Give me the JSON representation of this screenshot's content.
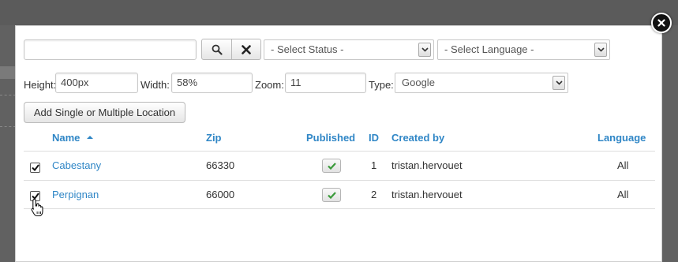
{
  "toolbar": {
    "search": {
      "value": "",
      "placeholder": ""
    },
    "status_select": {
      "selected": "- Select Status -"
    },
    "language_select": {
      "selected": "- Select Language -"
    }
  },
  "map_settings": {
    "height_label": "Height:",
    "height_value": "400px",
    "width_label": "Width:",
    "width_value": "58%",
    "zoom_label": "Zoom:",
    "zoom_value": "11",
    "type_label": "Type:",
    "type_selected": "Google"
  },
  "add_button_label": "Add Single or Multiple Location",
  "table": {
    "headers": {
      "name": "Name",
      "zip": "Zip",
      "published": "Published",
      "id": "ID",
      "created_by": "Created by",
      "language": "Language"
    },
    "sort": {
      "column": "Name",
      "direction": "ascending"
    },
    "rows": [
      {
        "checked": true,
        "name": "Cabestany",
        "zip": "66330",
        "published": true,
        "id": "1",
        "created_by": "tristan.hervouet",
        "language": "All"
      },
      {
        "checked": true,
        "name": "Perpignan",
        "zip": "66000",
        "published": true,
        "id": "2",
        "created_by": "tristan.hervouet",
        "language": "All"
      }
    ]
  },
  "icons": {
    "close": "close-icon",
    "search": "search-icon",
    "clear": "clear-icon",
    "dropdown": "chevron-down-icon",
    "sort": "sort-ascending-icon",
    "published": "check-icon",
    "cursor": "hand-pointer-icon"
  },
  "colors": {
    "link": "#2f86c6",
    "published_check": "#3a9a3a",
    "overlay": "#616161"
  }
}
